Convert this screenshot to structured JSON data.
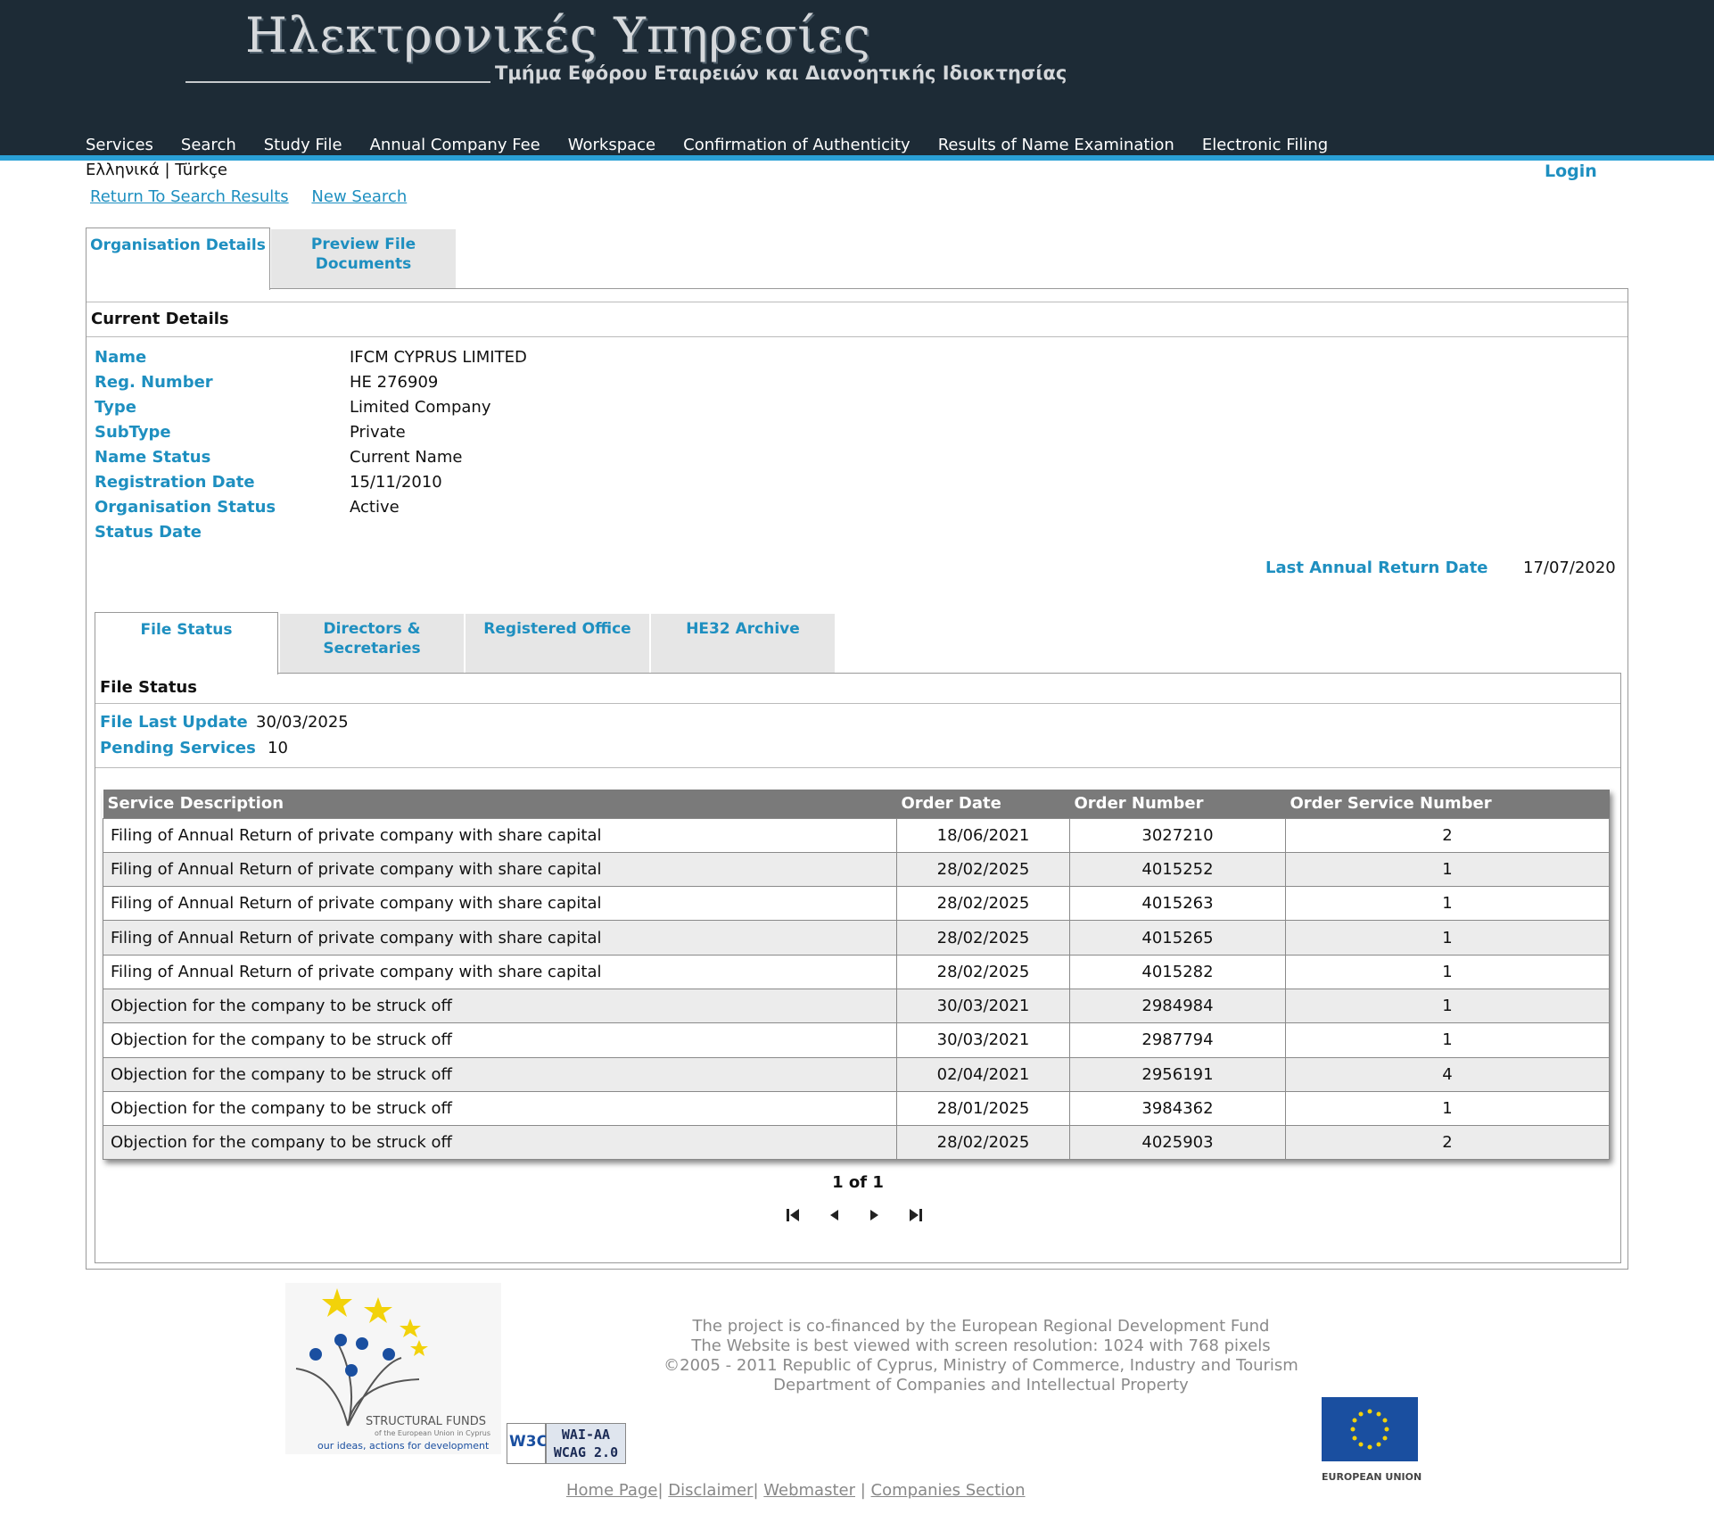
{
  "header": {
    "title": "Ηλεκτρονικές Υπηρεσίες",
    "subtitle": "Τμήμα Εφόρου Εταιρειών και Διανοητικής Ιδιοκτησίας",
    "nav": [
      "Services",
      "Search",
      "Study File",
      "Annual Company Fee",
      "Workspace",
      "Confirmation of Authenticity",
      "Results of Name Examination",
      "Electronic Filing"
    ],
    "lang_greek": "Ελληνικά",
    "lang_sep": "|",
    "lang_turkish": "Türkçe",
    "login": "Login"
  },
  "links": {
    "return": "Return To Search Results",
    "new_search": "New Search"
  },
  "tabs": {
    "org_details": "Organisation Details",
    "preview": "Preview File Documents"
  },
  "current": {
    "heading": "Current Details",
    "fields": [
      {
        "label": "Name",
        "value": "IFCM CYPRUS LIMITED"
      },
      {
        "label": "Reg. Number",
        "value": "HE 276909"
      },
      {
        "label": "Type",
        "value": "Limited Company"
      },
      {
        "label": "SubType",
        "value": "Private"
      },
      {
        "label": "Name Status",
        "value": "Current Name"
      },
      {
        "label": "Registration Date",
        "value": "15/11/2010"
      },
      {
        "label": "Organisation Status",
        "value": "Active"
      },
      {
        "label": "Status Date",
        "value": ""
      }
    ],
    "last_annual_label": "Last Annual Return Date",
    "last_annual_value": "17/07/2020"
  },
  "subtabs": [
    "File Status",
    "Directors & Secretaries",
    "Registered Office",
    "HE32 Archive"
  ],
  "file_status": {
    "heading": "File Status",
    "last_update_label": "File Last Update",
    "last_update_value": "30/03/2025",
    "pending_label": "Pending Services",
    "pending_value": "10",
    "columns": [
      "Service Description",
      "Order Date",
      "Order Number",
      "Order Service Number"
    ],
    "rows": [
      [
        "Filing of Annual Return of private company with share capital",
        "18/06/2021",
        "3027210",
        "2"
      ],
      [
        "Filing of Annual Return of private company with share capital",
        "28/02/2025",
        "4015252",
        "1"
      ],
      [
        "Filing of Annual Return of private company with share capital",
        "28/02/2025",
        "4015263",
        "1"
      ],
      [
        "Filing of Annual Return of private company with share capital",
        "28/02/2025",
        "4015265",
        "1"
      ],
      [
        "Filing of Annual Return of private company with share capital",
        "28/02/2025",
        "4015282",
        "1"
      ],
      [
        "Objection for the company to be struck off",
        "30/03/2021",
        "2984984",
        "1"
      ],
      [
        "Objection for the company to be struck off",
        "30/03/2021",
        "2987794",
        "1"
      ],
      [
        "Objection for the company to be struck off",
        "02/04/2021",
        "2956191",
        "4"
      ],
      [
        "Objection for the company to be struck off",
        "28/01/2025",
        "3984362",
        "1"
      ],
      [
        "Objection for the company to be struck off",
        "28/02/2025",
        "4025903",
        "2"
      ]
    ],
    "pager": "1 of 1"
  },
  "footer": {
    "lines": [
      "The project is co-financed by the European Regional Development Fund",
      "The Website is best viewed with screen resolution: 1024 with 768 pixels",
      "©2005 - 2011 Republic of Cyprus, Ministry of Commerce, Industry and Tourism",
      "Department of Companies and Intellectual Property"
    ],
    "sf_title": "STRUCTURAL FUNDS",
    "sf_sub": "of the European Union in Cyprus",
    "sf_tag": "our ideas, actions for development",
    "w3c": "W3C",
    "wai": "WAI-AA",
    "wcag": "WCAG 2.0",
    "eu": "EUROPEAN UNION",
    "links": [
      "Home Page",
      "Disclaimer",
      "Webmaster",
      "Companies Section"
    ],
    "sep": "|"
  },
  "colors": {
    "header_bg": "#1d2b36",
    "accent": "#1e8fc0",
    "stripe": "#2aa0d6",
    "table_header": "#7a7a7a"
  }
}
